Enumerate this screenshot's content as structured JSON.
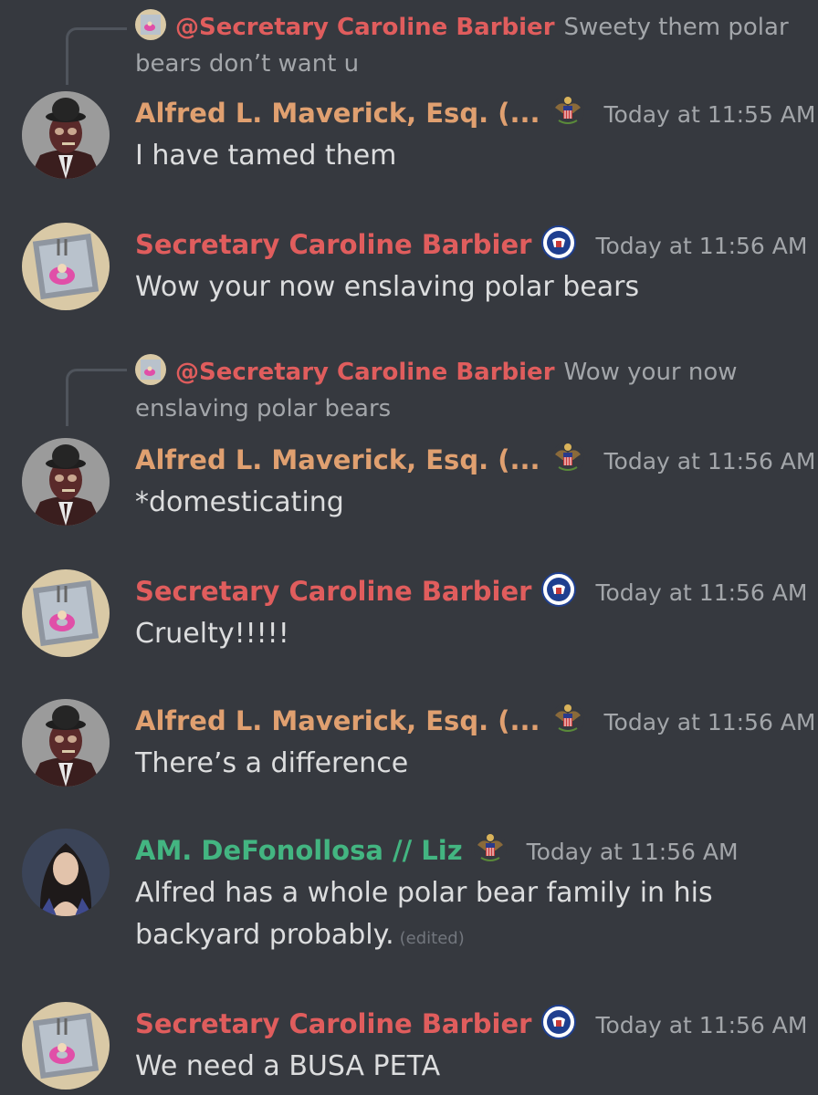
{
  "colors": {
    "background": "#36393f",
    "alfred_name": "#e0a070",
    "caroline_name": "#e05d5d",
    "liz_name": "#43b581",
    "timestamp": "#a3a6aa",
    "reply_text": "#a3a6aa"
  },
  "replies": [
    {
      "mention": "@Secretary Caroline Barbier",
      "text": "Sweety them polar bears don’t want u"
    },
    {
      "mention": "@Secretary Caroline Barbier",
      "text": "Wow your now enslaving polar bears"
    }
  ],
  "messages": [
    {
      "author": "Alfred L. Maverick, Esq. (...",
      "badge_icon": "eagle-seal-icon",
      "time": "Today at 11:55 AM",
      "text": "I have tamed them"
    },
    {
      "author": "Secretary Caroline Barbier",
      "badge_icon": "dhs-seal-icon",
      "time": "Today at 11:56 AM",
      "text": "Wow your now enslaving polar bears"
    },
    {
      "author": "Alfred L. Maverick, Esq. (...",
      "badge_icon": "eagle-seal-icon",
      "time": "Today at 11:56 AM",
      "text": "*domesticating"
    },
    {
      "author": "Secretary Caroline Barbier",
      "badge_icon": "dhs-seal-icon",
      "time": "Today at 11:56 AM",
      "text": "Cruelty!!!!!"
    },
    {
      "author": "Alfred L. Maverick, Esq. (...",
      "badge_icon": "eagle-seal-icon",
      "time": "Today at 11:56 AM",
      "text": "There’s a difference"
    },
    {
      "author": "AM. DeFonollosa // Liz",
      "badge_icon": "eagle-seal-icon",
      "time": "Today at 11:56 AM",
      "text": "Alfred has a whole polar bear family in his backyard probably.",
      "edited": "(edited)"
    },
    {
      "author": "Secretary Caroline Barbier",
      "badge_icon": "dhs-seal-icon",
      "time": "Today at 11:56 AM",
      "text": "We need a BUSA PETA"
    }
  ]
}
